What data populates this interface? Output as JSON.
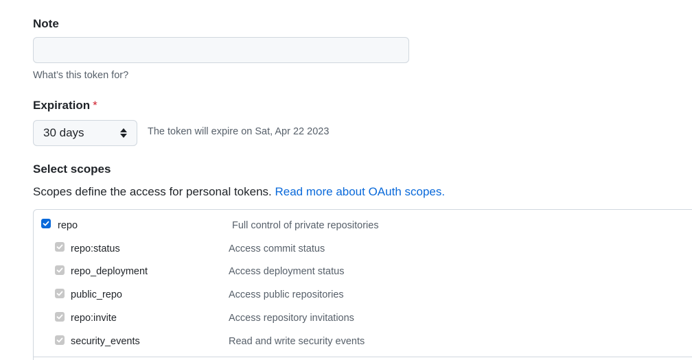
{
  "note": {
    "label": "Note",
    "value": "",
    "placeholder": "",
    "hint": "What’s this token for?"
  },
  "expiration": {
    "label": "Expiration",
    "required_mark": "*",
    "selected": "30 days",
    "expire_text": "The token will expire on Sat, Apr 22 2023"
  },
  "scopes": {
    "heading": "Select scopes",
    "description": "Scopes define the access for personal tokens.",
    "link_text": "Read more about OAuth scopes.",
    "parent": {
      "name": "repo",
      "description": "Full control of private repositories",
      "checked": true
    },
    "children": [
      {
        "name": "repo:status",
        "description": "Access commit status",
        "checked": true
      },
      {
        "name": "repo_deployment",
        "description": "Access deployment status",
        "checked": true
      },
      {
        "name": "public_repo",
        "description": "Access public repositories",
        "checked": true
      },
      {
        "name": "repo:invite",
        "description": "Access repository invitations",
        "checked": true
      },
      {
        "name": "security_events",
        "description": "Read and write security events",
        "checked": true
      }
    ]
  },
  "colors": {
    "accent": "#0969da",
    "required": "#cf222e",
    "muted_text": "#57606a",
    "border": "#d0d7de",
    "disabled_checkbox": "#c8c8c8"
  }
}
